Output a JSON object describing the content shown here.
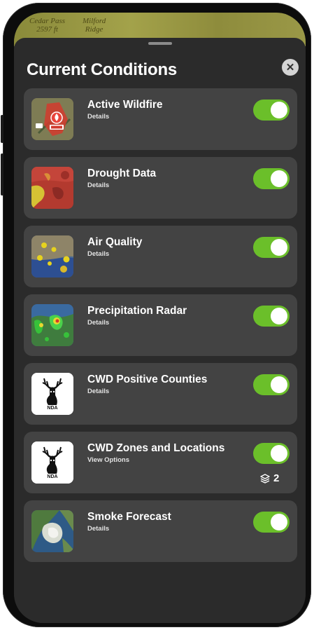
{
  "map": {
    "labels": [
      "Cedar Pass\n2597 ft",
      "Milford\nRidge"
    ]
  },
  "sheet": {
    "title": "Current Conditions",
    "close_icon": "close-icon"
  },
  "layers": [
    {
      "title": "Active Wildfire",
      "link": "Details",
      "enabled": true,
      "icon": "wildfire-map-thumbnail"
    },
    {
      "title": "Drought Data",
      "link": "Details",
      "enabled": true,
      "icon": "drought-map-thumbnail"
    },
    {
      "title": "Air Quality",
      "link": "Details",
      "enabled": true,
      "icon": "air-quality-map-thumbnail"
    },
    {
      "title": "Precipitation Radar",
      "link": "Details",
      "enabled": true,
      "icon": "radar-map-thumbnail"
    },
    {
      "title": "CWD Positive Counties",
      "link": "Details",
      "enabled": true,
      "icon": "nda-deer-logo"
    },
    {
      "title": "CWD Zones and Locations",
      "link": "View Options",
      "enabled": true,
      "icon": "nda-deer-logo",
      "layer_count": "2"
    },
    {
      "title": "Smoke Forecast",
      "link": "Details",
      "enabled": true,
      "icon": "smoke-map-thumbnail"
    }
  ],
  "logo": {
    "text": "NDA"
  },
  "colors": {
    "toggle_on": "#6bbf2a",
    "card": "#434343",
    "sheet": "#2b2b2b"
  }
}
